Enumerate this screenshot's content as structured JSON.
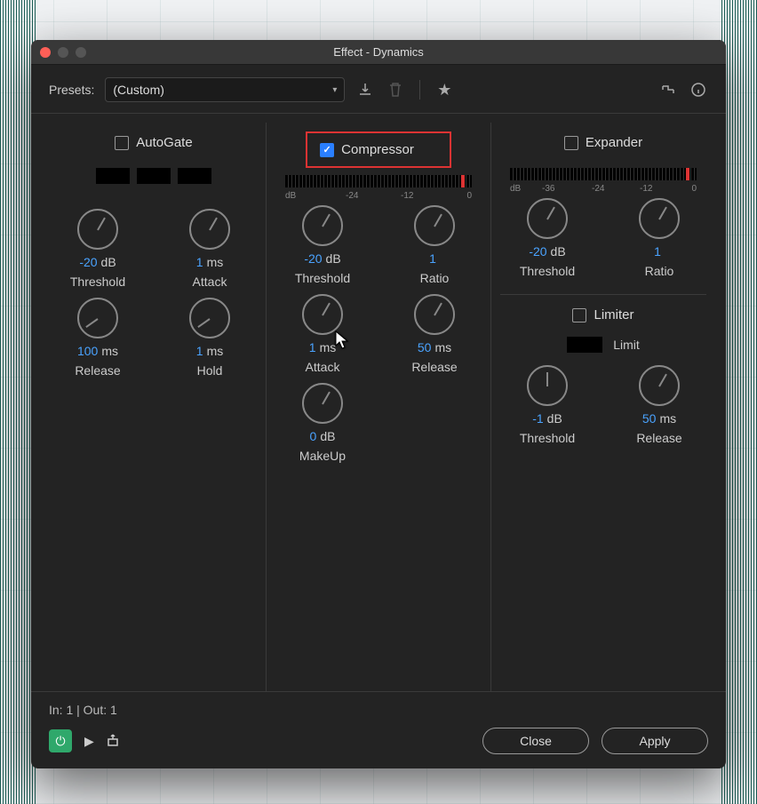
{
  "window": {
    "title": "Effect - Dynamics"
  },
  "toolbar": {
    "presets_label": "Presets:",
    "preset_value": "(Custom)"
  },
  "autogate": {
    "label": "AutoGate",
    "checked": false,
    "knobs": {
      "threshold": {
        "value": "-20",
        "unit": "dB",
        "label": "Threshold"
      },
      "attack": {
        "value": "1",
        "unit": "ms",
        "label": "Attack"
      },
      "release": {
        "value": "100",
        "unit": "ms",
        "label": "Release"
      },
      "hold": {
        "value": "1",
        "unit": "ms",
        "label": "Hold"
      }
    }
  },
  "compressor": {
    "label": "Compressor",
    "checked": true,
    "meter_ticks": {
      "db": "dB",
      "t1": "-24",
      "t2": "-12",
      "t3": "0"
    },
    "knobs": {
      "threshold": {
        "value": "-20",
        "unit": "dB",
        "label": "Threshold"
      },
      "ratio": {
        "value": "1",
        "unit": "",
        "label": "Ratio"
      },
      "attack": {
        "value": "1",
        "unit": "ms",
        "label": "Attack"
      },
      "release": {
        "value": "50",
        "unit": "ms",
        "label": "Release"
      },
      "makeup": {
        "value": "0",
        "unit": "dB",
        "label": "MakeUp"
      }
    }
  },
  "expander": {
    "label": "Expander",
    "checked": false,
    "meter_ticks": {
      "db": "dB",
      "t0": "-36",
      "t1": "-24",
      "t2": "-12",
      "t3": "0"
    },
    "knobs": {
      "threshold": {
        "value": "-20",
        "unit": "dB",
        "label": "Threshold"
      },
      "ratio": {
        "value": "1",
        "unit": "",
        "label": "Ratio"
      }
    }
  },
  "limiter": {
    "label": "Limiter",
    "checked": false,
    "limit_label": "Limit",
    "knobs": {
      "threshold": {
        "value": "-1",
        "unit": "dB",
        "label": "Threshold"
      },
      "release": {
        "value": "50",
        "unit": "ms",
        "label": "Release"
      }
    }
  },
  "footer": {
    "io": "In: 1 | Out: 1",
    "close": "Close",
    "apply": "Apply"
  }
}
